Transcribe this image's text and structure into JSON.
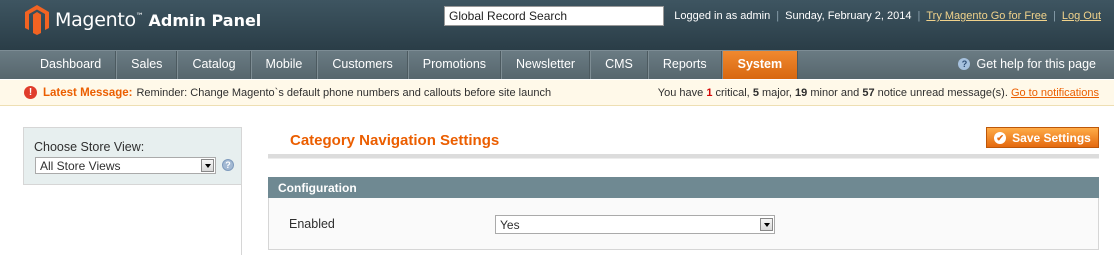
{
  "header": {
    "brand": "Magento",
    "brand_suffix": "Admin Panel",
    "search_value": "Global Record Search",
    "logged_in": "Logged in as admin",
    "date": "Sunday, February 2, 2014",
    "try_link": "Try Magento Go for Free",
    "logout": "Log Out"
  },
  "nav": {
    "items": [
      "Dashboard",
      "Sales",
      "Catalog",
      "Mobile",
      "Customers",
      "Promotions",
      "Newsletter",
      "CMS",
      "Reports",
      "System"
    ],
    "active": "System",
    "help": "Get help for this page"
  },
  "messages": {
    "latest_label": "Latest Message:",
    "latest_text": "Reminder: Change Magento`s default phone numbers and callouts before site launch",
    "summary_prefix": "You have",
    "critical_count": "1",
    "critical_label": "critical,",
    "major_count": "5",
    "major_label": "major,",
    "minor_count": "19",
    "minor_label": "minor and",
    "notice_count": "57",
    "notice_label": "notice unread message(s).",
    "notifications_link": "Go to notifications"
  },
  "sidebar": {
    "store_label": "Choose Store View:",
    "store_value": "All Store Views"
  },
  "main": {
    "title": "Category Navigation Settings",
    "save_label": "Save Settings",
    "fieldset_title": "Configuration",
    "enabled_label": "Enabled",
    "enabled_value": "Yes"
  },
  "colors": {
    "accent": "#eb5e00",
    "header_bg": "#2f4550",
    "nav_bg": "#5f7078",
    "fieldset_head": "#6f8992"
  }
}
